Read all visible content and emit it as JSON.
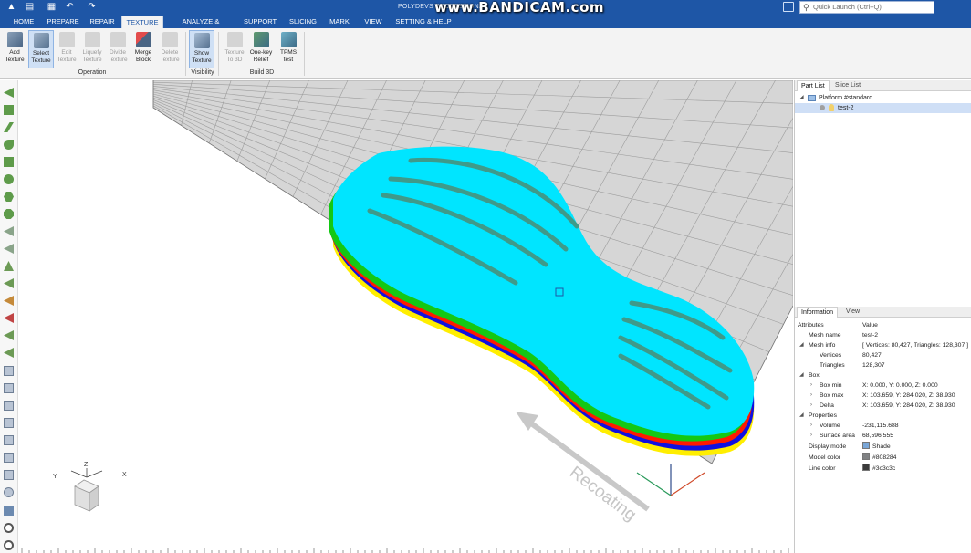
{
  "app": {
    "title": "POLYDEVS PROFESSIONAL",
    "watermark": "www.BANDICAM.com",
    "quick_launch_placeholder": "Quick Launch (Ctrl+Q)"
  },
  "tabs": [
    {
      "label": "HOME"
    },
    {
      "label": "PREPARE"
    },
    {
      "label": "REPAIR"
    },
    {
      "label": "TEXTURE",
      "active": true
    },
    {
      "label": "ANALYZE & REPORT"
    },
    {
      "label": "SUPPORT"
    },
    {
      "label": "SLICING"
    },
    {
      "label": "MARK"
    },
    {
      "label": "VIEW"
    },
    {
      "label": "SETTING & HELP"
    }
  ],
  "ribbon": {
    "operation": {
      "label": "Operation",
      "buttons": [
        {
          "l1": "Add",
          "l2": "Texture",
          "icon": "add-texture-icon",
          "enabled": true
        },
        {
          "l1": "Select",
          "l2": "Texture",
          "icon": "select-texture-icon",
          "enabled": true,
          "selected": true
        },
        {
          "l1": "Edit",
          "l2": "Texture",
          "icon": "edit-texture-icon",
          "enabled": false
        },
        {
          "l1": "Liquefy",
          "l2": "Texture",
          "icon": "liquefy-texture-icon",
          "enabled": false
        },
        {
          "l1": "Divide",
          "l2": "Texture",
          "icon": "divide-texture-icon",
          "enabled": false
        },
        {
          "l1": "Merge",
          "l2": "Block",
          "icon": "merge-block-icon",
          "enabled": true
        },
        {
          "l1": "Delete",
          "l2": "Texture",
          "icon": "delete-texture-icon",
          "enabled": false
        }
      ]
    },
    "visibility": {
      "label": "Visibility",
      "buttons": [
        {
          "l1": "Show",
          "l2": "Texture",
          "icon": "show-texture-icon",
          "enabled": true,
          "selected": true
        }
      ]
    },
    "build3d": {
      "label": "Build 3D",
      "buttons": [
        {
          "l1": "Texture",
          "l2": "To 3D",
          "icon": "texture-to-3d-icon",
          "enabled": false
        },
        {
          "l1": "One-key",
          "l2": "Relief",
          "icon": "one-key-relief-icon",
          "enabled": true
        },
        {
          "l1": "TPMS",
          "l2": "test",
          "icon": "tpms-test-icon",
          "enabled": true
        }
      ]
    }
  },
  "viewport": {
    "recoating_label": "Recoating",
    "cube_axes": {
      "x": "X",
      "y": "Y",
      "z": "Z"
    },
    "colors": {
      "mesh_top": "#00e5ff",
      "rib": "#3f9a8a",
      "layer_green": "#14c814",
      "layer_red": "#ff1a00",
      "layer_blue": "#1010e0",
      "layer_yellow": "#ffee00"
    }
  },
  "right_panel": {
    "tabs": {
      "part_list": "Part List",
      "slice_list": "Slice List",
      "information": "Information",
      "view": "View"
    },
    "tree": {
      "platform": "Platform #standard",
      "part": "test-2"
    },
    "info_header": {
      "attributes": "Attributes",
      "value": "Value"
    },
    "info": {
      "mesh_name_k": "Mesh name",
      "mesh_name_v": "test-2",
      "mesh_info_k": "Mesh info",
      "mesh_info_v": "[ Vertices: 80,427, Triangles: 128,307 ]",
      "vertices_k": "Vertices",
      "vertices_v": "80,427",
      "triangles_k": "Triangles",
      "triangles_v": "128,307",
      "box_k": "Box",
      "box_min_k": "Box min",
      "box_min_v": "X: 0.000, Y: 0.000, Z: 0.000",
      "box_max_k": "Box max",
      "box_max_v": "X: 103.659, Y: 284.020, Z: 38.930",
      "delta_k": "Delta",
      "delta_v": "X: 103.659, Y: 284.020, Z: 38.930",
      "properties_k": "Properties",
      "volume_k": "Volume",
      "volume_v": "-231,115.688",
      "surface_k": "Surface area",
      "surface_v": "68,596.555",
      "display_mode_k": "Display mode",
      "display_mode_v": "Shade",
      "model_color_k": "Model color",
      "model_color_v": "#808284",
      "line_color_k": "Line color",
      "line_color_v": "#3c3c3c"
    },
    "swatches": {
      "shade": "#7aa7d8",
      "model": "#808284",
      "line": "#3c3c3c"
    }
  }
}
